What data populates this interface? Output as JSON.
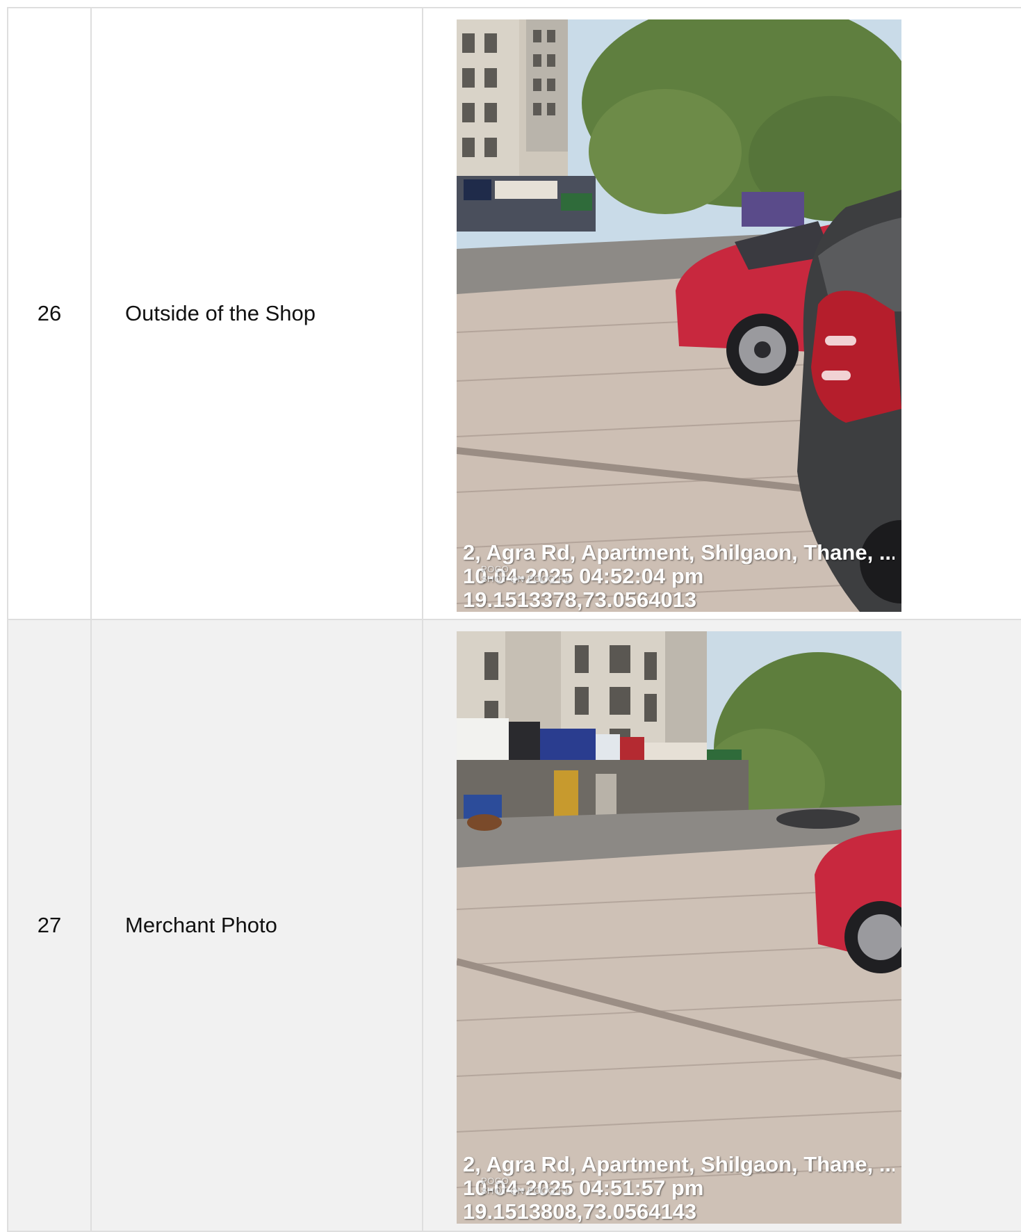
{
  "rows": [
    {
      "number": "26",
      "label": "Outside of the Shop",
      "photo": {
        "address": "2, Agra Rd, Apartment, Shilgaon, Thane, ...",
        "timestamp": "10-04-2025 04:52:04 pm",
        "coordinates": "19.1513378,73.0564013",
        "watermark_top": "POCO",
        "watermark_bottom": "SHOT ON POCO F1"
      }
    },
    {
      "number": "27",
      "label": "Merchant Photo",
      "photo": {
        "address": "2, Agra Rd, Apartment, Shilgaon, Thane, ...",
        "timestamp": "10-04-2025 04:51:57 pm",
        "coordinates": "19.1513808,73.0564143",
        "watermark_top": "POCO",
        "watermark_bottom": "SHOT ON POCO F1"
      }
    }
  ]
}
